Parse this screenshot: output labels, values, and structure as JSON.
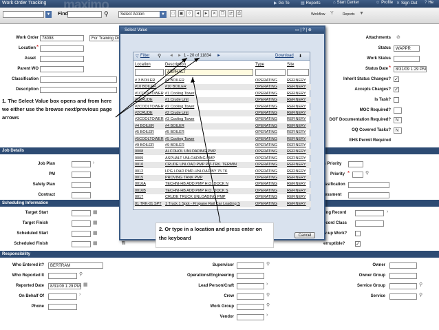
{
  "header": {
    "app_title": "Work Order Tracking",
    "brand": "maximo",
    "nav": [
      {
        "label": "Go To",
        "icon": "go-to-icon"
      },
      {
        "label": "Reports",
        "icon": "reports-icon"
      },
      {
        "label": "Start Center",
        "icon": "start-center-icon"
      },
      {
        "label": "Profile",
        "icon": "profile-icon"
      },
      {
        "label": "Sign Out",
        "icon": "sign-out-icon"
      },
      {
        "label": "He",
        "icon": "help-icon"
      }
    ]
  },
  "toolbar": {
    "find_label": "Find:",
    "select_action": "Select Action",
    "workflow_label": "Workflow",
    "reports_label": "Reports"
  },
  "form": {
    "work_order_label": "Work Order",
    "work_order_value": "78098",
    "description_value": "For Training Only-St",
    "location_label": "Location",
    "asset_label": "Asset",
    "parent_wo_label": "Parent WO",
    "classification_label": "Classification",
    "description_label": "Description",
    "attachments_label": "Attachments",
    "status_label": "Status",
    "status_value": "WAPPR",
    "work_status_label": "Work Status",
    "status_date_label": "Status Date",
    "status_date_value": "8/31/09 1:29 PM",
    "inherit_label": "Inherit Status Changes?",
    "accepts_label": "Accepts Charges?",
    "is_task_label": "Is Task?",
    "moc_label": "MOC Required?",
    "dot_label": "DOT Documentation Required?",
    "dot_value": "N",
    "oq_label": "OQ Covered Tasks?",
    "oq_value": "N",
    "ehs_label": "EHS Permit Required"
  },
  "job_details": {
    "section_label": "Job Details",
    "job_plan_label": "Job Plan",
    "pm_label": "PM",
    "safety_plan_label": "Safety Plan",
    "contract_label": "Contract",
    "priority_a_label": "n Priority",
    "priority_label": "Priority",
    "classification_label": "ssification",
    "assessment_label": "essment"
  },
  "scheduling": {
    "section_label": "Scheduling Information",
    "target_start_label": "Target Start",
    "target_finish_label": "Target Finish",
    "scheduled_start_label": "Scheduled Start",
    "scheduled_finish_label": "Scheduled Finish",
    "time_label": "Ti",
    "recording_label": "ting Record",
    "record_class_label": "ecord Class",
    "followup_label": "w-up Work?",
    "interruptible_label": "erruptible?"
  },
  "responsibility": {
    "section_label": "Responsibility",
    "who_entered_label": "Who Entered it?",
    "who_entered_value": "BERTRAM",
    "who_reported_label": "Who Reported It",
    "reported_date_label": "Reported Date",
    "reported_date_value": "8/31/09 1:29 PM",
    "on_behalf_label": "On Behalf Of",
    "phone_label": "Phone",
    "supervisor_label": "Supervisor",
    "ops_label": "Operations/Engineering",
    "lead_label": "Lead Person/Craft",
    "crew_label": "Crew",
    "work_group_label": "Work Group",
    "vendor_label": "Vendor",
    "owner_label": "Owner",
    "owner_group_label": "Owner Group",
    "service_group_label": "Service Group",
    "service_label": "Service"
  },
  "dialog": {
    "title": "Select Value",
    "filter_label": "Filter",
    "pager": "1 - 20 of 11834",
    "download_label": "Download",
    "columns": [
      "Location",
      "Description",
      "Type",
      "Site"
    ],
    "description_filter": "ASPHALT",
    "rows": [
      [
        "# 3 BOILER",
        "#3 BOILER",
        "OPERATING",
        "REFINERY"
      ],
      [
        "#10 BOILER",
        "#10 BOILER",
        "OPERATING",
        "REFINERY"
      ],
      [
        "#1COOLTOWER",
        "#1 Cooling Tower",
        "OPERATING",
        "REFINERY"
      ],
      [
        "#1CRUDE",
        "#1 Crude Unit",
        "OPERATING",
        "REFINERY"
      ],
      [
        "#2COOLTOWER",
        "#2 Cooling Tower",
        "OPERATING",
        "REFINERY"
      ],
      [
        "#2CRUDE",
        "#2 Crude Unit",
        "OPERATING",
        "REFINERY"
      ],
      [
        "#3COOLTOWER",
        "#3 Cooling Tower",
        "OPERATING",
        "REFINERY"
      ],
      [
        "#4 BOILER",
        "#4 BOILER",
        "OPERATING",
        "REFINERY"
      ],
      [
        "#5 BOILER",
        "#5 BOILER",
        "OPERATING",
        "REFINERY"
      ],
      [
        "#5COOLTOWER",
        "#5 Cooling Tower",
        "OPERATING",
        "REFINERY"
      ],
      [
        "#9 BOILER",
        "#9 BOILER",
        "OPERATING",
        "REFINERY"
      ],
      [
        "0008",
        "ALCOHOL UNLOADING PMP",
        "OPERATING",
        "REFINERY"
      ],
      [
        "0009",
        "ASPHALT UNLOADING PMP",
        "OPERATING",
        "REFINERY"
      ],
      [
        "0010",
        "CRUDE UNLOAD PMP PIT-TRK. TERMIN",
        "OPERATING",
        "REFINERY"
      ],
      [
        "0012",
        "LPG LOAD PMP-UNLOAD BY 75 TK",
        "OPERATING",
        "REFINERY"
      ],
      [
        "0015",
        "PROVING TANK PMP",
        "OPERATING",
        "REFINERY"
      ],
      [
        "0016A",
        "TECHNI-HB ADD PMP H.O. DOCK N",
        "OPERATING",
        "REFINERY"
      ],
      [
        "0016B",
        "TECHNI-HB ADD PMP H.O. DOCK S",
        "OPERATING",
        "REFINERY"
      ],
      [
        "0017",
        "CRUDE TRUCK UNLOADING PMP",
        "OPERATING",
        "REFINERY"
      ],
      [
        "01 TRK-01 SPT",
        "1 Truck 1 Spot - Propane Rail Car Loading S",
        "OPERATING",
        "REFINERY"
      ]
    ],
    "cancel_label": "Cancel"
  },
  "annotations": {
    "note1": "1.  The Select Value box opens and from here we either use the browse next/previous page arrows",
    "note2": "2.  Or type in a location and press enter on the keyboard"
  }
}
